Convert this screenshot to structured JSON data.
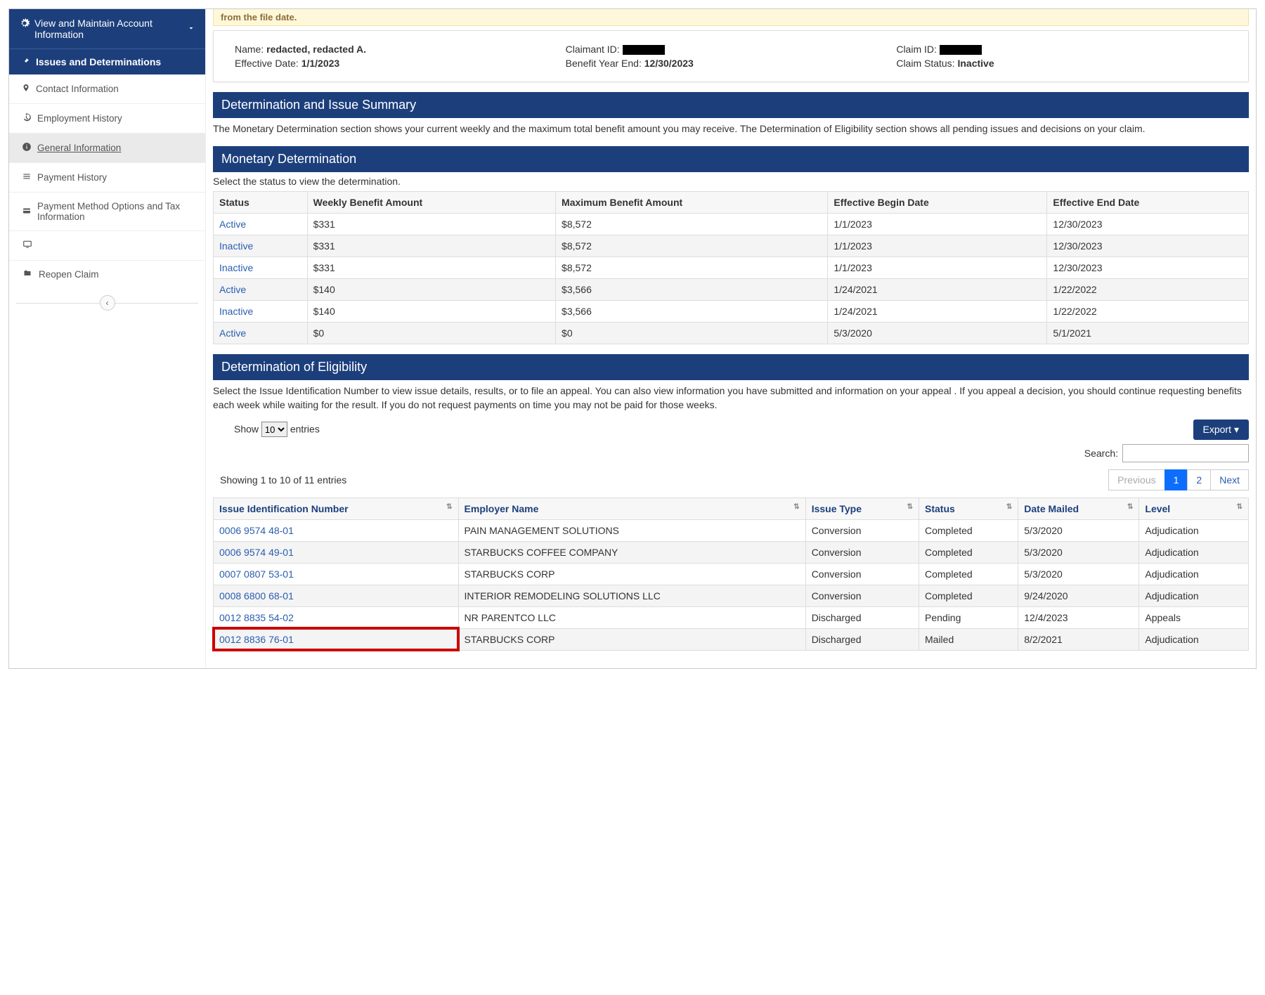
{
  "sidebar": {
    "header": "View and Maintain Account Information",
    "active": "Issues and Determinations",
    "items": {
      "contact": "Contact Information",
      "employment": "Employment History",
      "general": "General Information",
      "payment_history": "Payment History",
      "payment_method": "Payment Method Options and Tax Information",
      "blank": "",
      "reopen": "Reopen Claim"
    }
  },
  "banner": "from the file date.",
  "claimant": {
    "name_label": "Name:",
    "name": "redacted, redacted A.",
    "claimant_id_label": "Claimant ID:",
    "claim_id_label": "Claim ID:",
    "effective_label": "Effective Date:",
    "effective": "1/1/2023",
    "bye_label": "Benefit Year End:",
    "bye": "12/30/2023",
    "status_label": "Claim Status:",
    "status": "Inactive"
  },
  "summary": {
    "title": "Determination and Issue Summary",
    "desc": "The Monetary Determination section shows your current weekly and the maximum total benefit amount you may receive. The Determination of Eligibility section shows all pending issues and decisions on your claim."
  },
  "monetary": {
    "title": "Monetary Determination",
    "desc": "Select the status to view the determination.",
    "headers": {
      "status": "Status",
      "weekly": "Weekly Benefit Amount",
      "max": "Maximum Benefit Amount",
      "begin": "Effective Begin Date",
      "end": "Effective End Date"
    },
    "rows": [
      {
        "status": "Active",
        "weekly": "$331",
        "max": "$8,572",
        "begin": "1/1/2023",
        "end": "12/30/2023"
      },
      {
        "status": "Inactive",
        "weekly": "$331",
        "max": "$8,572",
        "begin": "1/1/2023",
        "end": "12/30/2023"
      },
      {
        "status": "Inactive",
        "weekly": "$331",
        "max": "$8,572",
        "begin": "1/1/2023",
        "end": "12/30/2023"
      },
      {
        "status": "Active",
        "weekly": "$140",
        "max": "$3,566",
        "begin": "1/24/2021",
        "end": "1/22/2022"
      },
      {
        "status": "Inactive",
        "weekly": "$140",
        "max": "$3,566",
        "begin": "1/24/2021",
        "end": "1/22/2022"
      },
      {
        "status": "Active",
        "weekly": "$0",
        "max": "$0",
        "begin": "5/3/2020",
        "end": "5/1/2021"
      }
    ]
  },
  "eligibility": {
    "title": "Determination of Eligibility",
    "desc": "Select the Issue Identification Number to view issue details, results, or to file an appeal. You can also view information you have submitted and information on your appeal . If you appeal a decision, you should continue requesting benefits each week while waiting for the result. If you do not request payments on time you may not be paid for those weeks.",
    "show_label": "Show",
    "entries_value": "10",
    "entries_label": "entries",
    "export": "Export",
    "search_label": "Search:",
    "showing": "Showing 1 to 10 of 11 entries",
    "pager": {
      "prev": "Previous",
      "p1": "1",
      "p2": "2",
      "next": "Next"
    },
    "headers": {
      "issue": "Issue Identification Number",
      "employer": "Employer Name",
      "type": "Issue Type",
      "status": "Status",
      "mailed": "Date Mailed",
      "level": "Level"
    },
    "rows": [
      {
        "issue": "0006 9574 48-01",
        "employer": "PAIN MANAGEMENT SOLUTIONS",
        "type": "Conversion",
        "status": "Completed",
        "mailed": "5/3/2020",
        "level": "Adjudication"
      },
      {
        "issue": "0006 9574 49-01",
        "employer": "STARBUCKS COFFEE COMPANY",
        "type": "Conversion",
        "status": "Completed",
        "mailed": "5/3/2020",
        "level": "Adjudication"
      },
      {
        "issue": "0007 0807 53-01",
        "employer": "STARBUCKS CORP",
        "type": "Conversion",
        "status": "Completed",
        "mailed": "5/3/2020",
        "level": "Adjudication"
      },
      {
        "issue": "0008 6800 68-01",
        "employer": "INTERIOR REMODELING SOLUTIONS LLC",
        "type": "Conversion",
        "status": "Completed",
        "mailed": "9/24/2020",
        "level": "Adjudication"
      },
      {
        "issue": "0012 8835 54-02",
        "employer": "NR PARENTCO LLC",
        "type": "Discharged",
        "status": "Pending",
        "mailed": "12/4/2023",
        "level": "Appeals"
      },
      {
        "issue": "0012 8836 76-01",
        "employer": "STARBUCKS CORP",
        "type": "Discharged",
        "status": "Mailed",
        "mailed": "8/2/2021",
        "level": "Adjudication"
      }
    ]
  }
}
